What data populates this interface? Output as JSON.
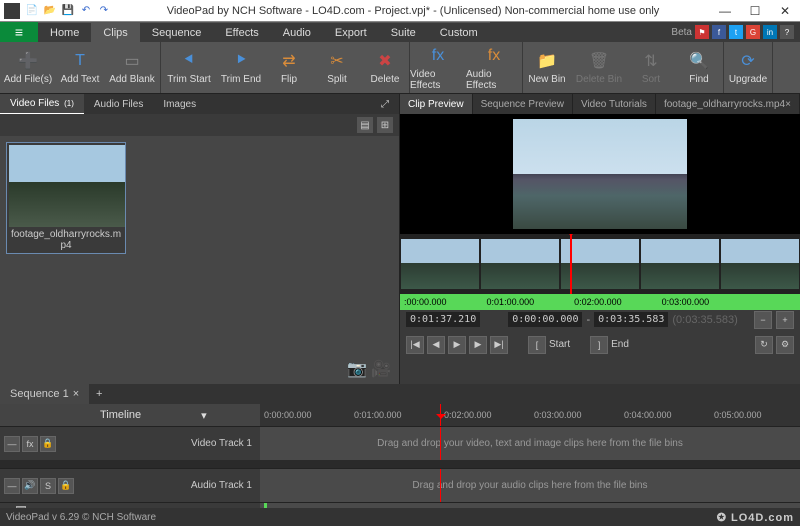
{
  "titlebar": {
    "title": "VideoPad by NCH Software - LO4D.com - Project.vpj* - (Unlicensed) Non-commercial home use only"
  },
  "menu": {
    "tabs": [
      "Home",
      "Clips",
      "Sequence",
      "Effects",
      "Audio",
      "Export",
      "Suite",
      "Custom"
    ],
    "active_index": 1,
    "beta_label": "Beta"
  },
  "ribbon": {
    "groups": [
      [
        {
          "label": "Add File(s)",
          "icon": "➕",
          "color": "#4fa64f"
        },
        {
          "label": "Add Text",
          "icon": "T",
          "color": "#4a90d9"
        },
        {
          "label": "Add Blank",
          "icon": "▭",
          "color": "#888"
        }
      ],
      [
        {
          "label": "Trim Start",
          "icon": "⯇",
          "color": "#4a90d9"
        },
        {
          "label": "Trim End",
          "icon": "⯈",
          "color": "#4a90d9"
        },
        {
          "label": "Flip",
          "icon": "⇄",
          "color": "#d98c3a"
        },
        {
          "label": "Split",
          "icon": "✂",
          "color": "#d98c3a"
        },
        {
          "label": "Delete",
          "icon": "✖",
          "color": "#c44"
        }
      ],
      [
        {
          "label": "Video Effects",
          "icon": "fx",
          "color": "#4a90d9"
        },
        {
          "label": "Audio Effects",
          "icon": "fx",
          "color": "#d98c3a"
        }
      ],
      [
        {
          "label": "New Bin",
          "icon": "📁",
          "color": "#d98c3a"
        },
        {
          "label": "Delete Bin",
          "icon": "🗑",
          "color": "#777",
          "disabled": true
        },
        {
          "label": "Sort",
          "icon": "⇅",
          "color": "#777",
          "disabled": true
        },
        {
          "label": "Find",
          "icon": "🔍",
          "color": "#4a90d9"
        }
      ],
      [
        {
          "label": "Upgrade",
          "icon": "⟳",
          "color": "#4a90d9"
        }
      ]
    ]
  },
  "bins": {
    "tabs": [
      {
        "label": "Video Files",
        "count": "(1)"
      },
      {
        "label": "Audio Files",
        "count": ""
      },
      {
        "label": "Images",
        "count": ""
      }
    ],
    "active_index": 0,
    "clips": [
      {
        "name": "footage_oldharryrocks.mp4"
      }
    ]
  },
  "preview": {
    "tabs": [
      "Clip Preview",
      "Sequence Preview",
      "Video Tutorials",
      "footage_oldharryrocks.mp4"
    ],
    "active_index": 0,
    "timecodes": [
      ":00:00.000",
      "0:01:00.000",
      "0:02:00.000",
      "0:03:00.000"
    ],
    "transport": {
      "current": "0:01:37.210",
      "in_label": "Start",
      "in_tc": "0:00:00.000",
      "out_label": "End",
      "out_tc": "0:03:35.583",
      "duration": "(0:03:35.583)"
    }
  },
  "timeline": {
    "seq_tab": "Sequence 1",
    "header_label": "Timeline",
    "ticks": [
      "0:00:00.000",
      "0:01:00.000",
      "0:02:00.000",
      "0:03:00.000",
      "0:04:00.000",
      "0:05:00.000"
    ],
    "video_track_label": "Video Track 1",
    "video_hint": "Drag and drop your video, text and image clips here from the file bins",
    "audio_track_label": "Audio Track 1",
    "audio_hint": "Drag and drop your audio clips here from the file bins"
  },
  "status": {
    "left": "VideoPad v 6.29 © NCH Software",
    "right": "✪ LO4D.com"
  }
}
